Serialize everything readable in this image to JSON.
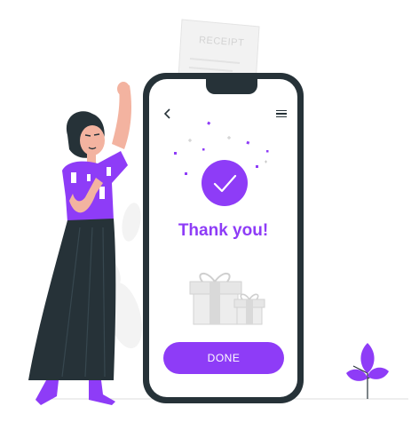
{
  "receipt": {
    "label": "RECEIPT"
  },
  "phone": {
    "header": {
      "back_icon": "chevron-left-icon",
      "menu_icon": "hamburger-menu-icon"
    },
    "confirmation": {
      "title": "Thank you!",
      "icon": "checkmark-icon"
    },
    "done_button": {
      "label": "DONE"
    }
  },
  "colors": {
    "accent": "#8e3cf7",
    "phone_frame": "#263238",
    "receipt_gray": "#e6e6e6",
    "gift_gray": "#dcdcdc"
  }
}
